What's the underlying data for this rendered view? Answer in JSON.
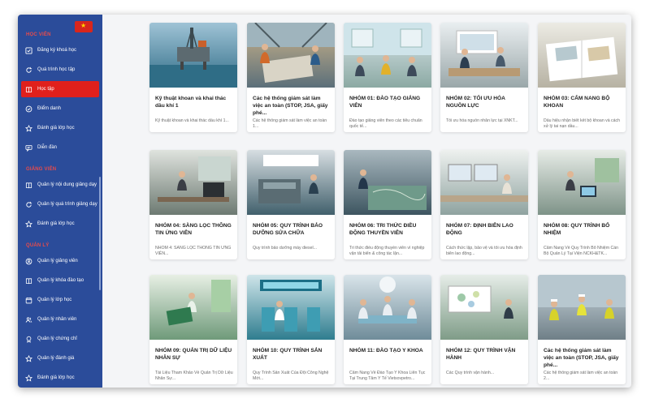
{
  "sidebar": {
    "sections": [
      {
        "title": "HỌC VIÊN",
        "items": [
          {
            "label": "Đăng ký khoá học",
            "icon": "checkbox-icon"
          },
          {
            "label": "Quá trình học tập",
            "icon": "refresh-icon"
          },
          {
            "label": "Học tập",
            "icon": "book-icon",
            "active": true
          },
          {
            "label": "Điểm danh",
            "icon": "check-circle-icon"
          },
          {
            "label": "Đánh giá lớp học",
            "icon": "star-icon"
          },
          {
            "label": "Diễn đàn",
            "icon": "forum-icon"
          }
        ]
      },
      {
        "title": "GIẢNG VIÊN",
        "items": [
          {
            "label": "Quản lý nội dung giảng dạy",
            "icon": "book-icon"
          },
          {
            "label": "Quản lý quá trình giảng dạy",
            "icon": "refresh-icon"
          },
          {
            "label": "Đánh giá lớp học",
            "icon": "star-icon"
          }
        ]
      },
      {
        "title": "QUẢN LÝ",
        "items": [
          {
            "label": "Quản lý giảng viên",
            "icon": "user-circle-icon"
          },
          {
            "label": "Quản lý khóa đào tạo",
            "icon": "book-icon"
          },
          {
            "label": "Quản lý lớp học",
            "icon": "calendar-icon"
          },
          {
            "label": "Quản lý nhân viên",
            "icon": "users-icon"
          },
          {
            "label": "Quản lý chứng chỉ",
            "icon": "certificate-icon"
          },
          {
            "label": "Quản lý đánh giá",
            "icon": "star-icon"
          },
          {
            "label": "Đánh giá lớp học",
            "icon": "star-icon"
          }
        ]
      }
    ]
  },
  "cards": [
    {
      "title": "Kỹ thuật khoan và khai thác dầu khí 1",
      "desc": "Kỹ thuật khoan và khai thác dầu khí 1...",
      "scene": "offshore-rig"
    },
    {
      "title": "Các hệ thống giám sát làm việc an toàn (STOP, JSA, giấy phé...",
      "desc": "Các hệ thống giám sát làm việc an toàn 1...",
      "scene": "rig-deck"
    },
    {
      "title": "NHÓM 01: ĐÀO TẠO GIẢNG VIÊN",
      "desc": "Đào tạo giảng viên theo các tiêu chuẩn quốc tế...",
      "scene": "classroom"
    },
    {
      "title": "NHÓM 02: TỐI ƯU HÓA NGUỒN LỰC",
      "desc": "Tối ưu hóa nguồn nhân lực tại XNKT...",
      "scene": "meeting"
    },
    {
      "title": "NHÓM 03: CẨM NANG BỘ KHOAN",
      "desc": "Dấu hiệu nhận biết kết bộ khoan và cách xử lý tai nạn dầu...",
      "scene": "manual"
    },
    {
      "title": "NHÓM 04: SÀNG LỌC THÔNG TIN ỨNG VIÊN",
      "desc": "NHÓM 4: SÀNG LỌC THÔNG TIN ỨNG VIÊN...",
      "scene": "office-woman"
    },
    {
      "title": "NHÓM 05: QUY TRÌNH BẢO DƯỠNG SỬA CHỮA",
      "desc": "Quy trình bảo dưỡng máy diesel...",
      "scene": "engine"
    },
    {
      "title": "NHÓM 06: TRI THỨC ĐIỀU ĐỘNG THUYỀN VIÊN",
      "desc": "Tri thức điều động thuyền viên vì nghiệp vận tải biển & công tác lặn...",
      "scene": "navigator"
    },
    {
      "title": "NHÓM 07: ĐỊNH BIÊN LAO ĐỘNG",
      "desc": "Cách thức lập, bảo vệ và tối ưu hóa định biên lao động...",
      "scene": "monitor-woman"
    },
    {
      "title": "NHÓM 08: QUY TRÌNH BỔ NHIỆM",
      "desc": "Cẩm Nang Về Quy Trình Bổ Nhiệm Cán Bộ Quản Lý Tại Viện NCKH&TK...",
      "scene": "tablet-woman"
    },
    {
      "title": "NHÓM 09: QUẢN TRỊ DỮ LIỆU NHÂN SỰ",
      "desc": "Tài Liệu Tham Khảo Về Quản Trị Dữ Liệu Nhân Sự...",
      "scene": "reading-woman"
    },
    {
      "title": "NHÓM 10: QUY TRÌNH SẢN XUẤT",
      "desc": "Quy Trình Sản Xuất Của Đội Công Nghệ Mới...",
      "scene": "factory"
    },
    {
      "title": "NHÓM 11: ĐÀO TẠO Y KHOA",
      "desc": "Cẩm Nang Về Đào Tạo Y Khoa Liên Tục Tại Trung Tâm Y Tế Vietsovpetro...",
      "scene": "surgery"
    },
    {
      "title": "NHÓM 12: QUY TRÌNH VẬN HÀNH",
      "desc": "Các Quy trình vận hành...",
      "scene": "diagram-screen"
    },
    {
      "title": "Các hệ thống giám sát làm việc an toàn (STOP, JSA, giấy phé...",
      "desc": "Các hệ thống giám sát làm việc an toàn 2...",
      "scene": "workers"
    }
  ]
}
